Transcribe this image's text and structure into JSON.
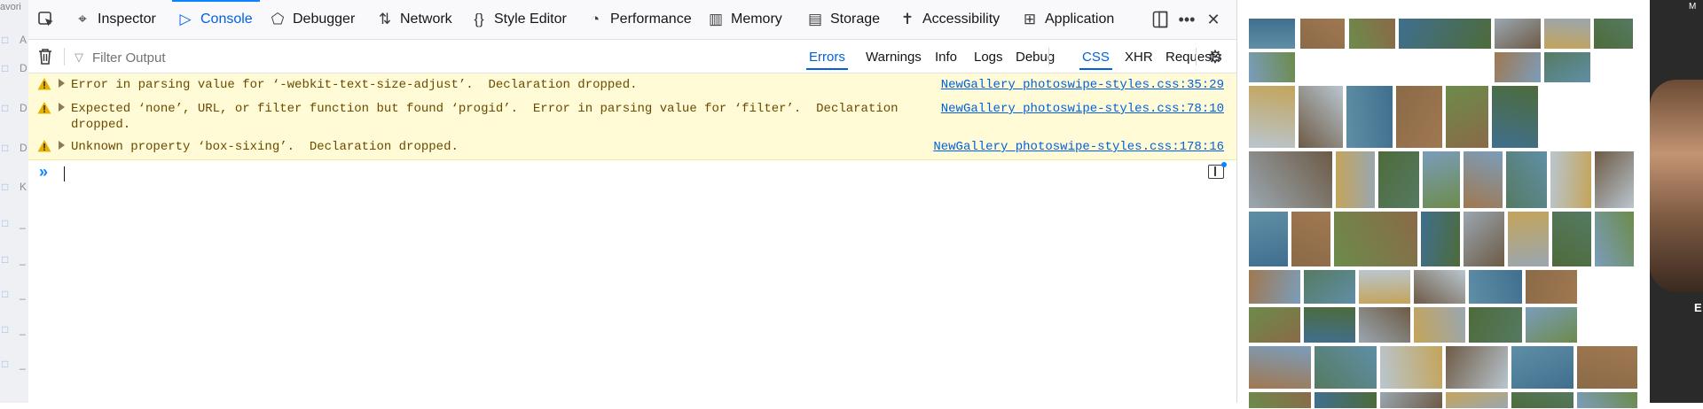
{
  "window": {
    "top_word_fragment": "avori",
    "right_edge_text_1": "M",
    "right_edge_text_2": "E"
  },
  "sidebar_fragments": [
    "A",
    "D",
    "D",
    "D",
    "K",
    "_",
    "_",
    "_",
    "_",
    "_"
  ],
  "devtools": {
    "tabs": [
      {
        "label": "Inspector",
        "icon": "inspector-icon",
        "glyph": "⌖"
      },
      {
        "label": "Console",
        "icon": "console-icon",
        "glyph": "▷"
      },
      {
        "label": "Debugger",
        "icon": "debugger-icon",
        "glyph": "⬠"
      },
      {
        "label": "Network",
        "icon": "network-icon",
        "glyph": "⇅"
      },
      {
        "label": "Style Editor",
        "icon": "style-editor-icon",
        "glyph": "{}"
      },
      {
        "label": "Performance",
        "icon": "performance-icon",
        "glyph": "◔"
      },
      {
        "label": "Memory",
        "icon": "memory-icon",
        "glyph": "▥"
      },
      {
        "label": "Storage",
        "icon": "storage-icon",
        "glyph": "▤"
      },
      {
        "label": "Accessibility",
        "icon": "accessibility-icon",
        "glyph": "✝"
      },
      {
        "label": "Application",
        "icon": "application-icon",
        "glyph": "⊞"
      }
    ],
    "active_tab": "Console",
    "toolbar_icons": [
      "pick-element-icon",
      "dock-icon",
      "more-options-icon",
      "close-icon"
    ],
    "filter": {
      "placeholder": "Filter Output",
      "buttons": [
        {
          "label": "Errors",
          "checked": true
        },
        {
          "label": "Warnings",
          "checked": false
        },
        {
          "label": "Info",
          "checked": false
        },
        {
          "label": "Logs",
          "checked": false
        },
        {
          "label": "Debug",
          "checked": false
        },
        {
          "label": "CSS",
          "checked": true
        },
        {
          "label": "XHR",
          "checked": false
        },
        {
          "label": "Requests",
          "checked": false
        }
      ]
    },
    "messages": [
      {
        "text": "Error in parsing value for ‘-webkit-text-size-adjust’.  Declaration dropped.",
        "source": "NewGallery_photoswipe-styles.css:35:29"
      },
      {
        "text": "Expected ‘none’, URL, or filter function but found ‘progid’.  Error in parsing value for ‘filter’.  Declaration\ndropped.",
        "source": "NewGallery_photoswipe-styles.css:78:10"
      },
      {
        "text": "Unknown property ‘box-sixing’.  Declaration dropped.",
        "source": "NewGallery_photoswipe-styles.css:178:16"
      }
    ],
    "prompt_symbol": "»"
  },
  "colors": {
    "accent": "#0060df",
    "warning_bg": "#fffbd6",
    "warning_icon": "#e5b000"
  },
  "gallery": {
    "palette": [
      "#5f8fa6",
      "#8a6a48",
      "#6c8b4b",
      "#3f6f8e",
      "#9aa7b0",
      "#c4a45a",
      "#4e6b3b",
      "#7b9dbb",
      "#a07850",
      "#557a62",
      "#b9c6cf",
      "#6d5a45"
    ]
  }
}
